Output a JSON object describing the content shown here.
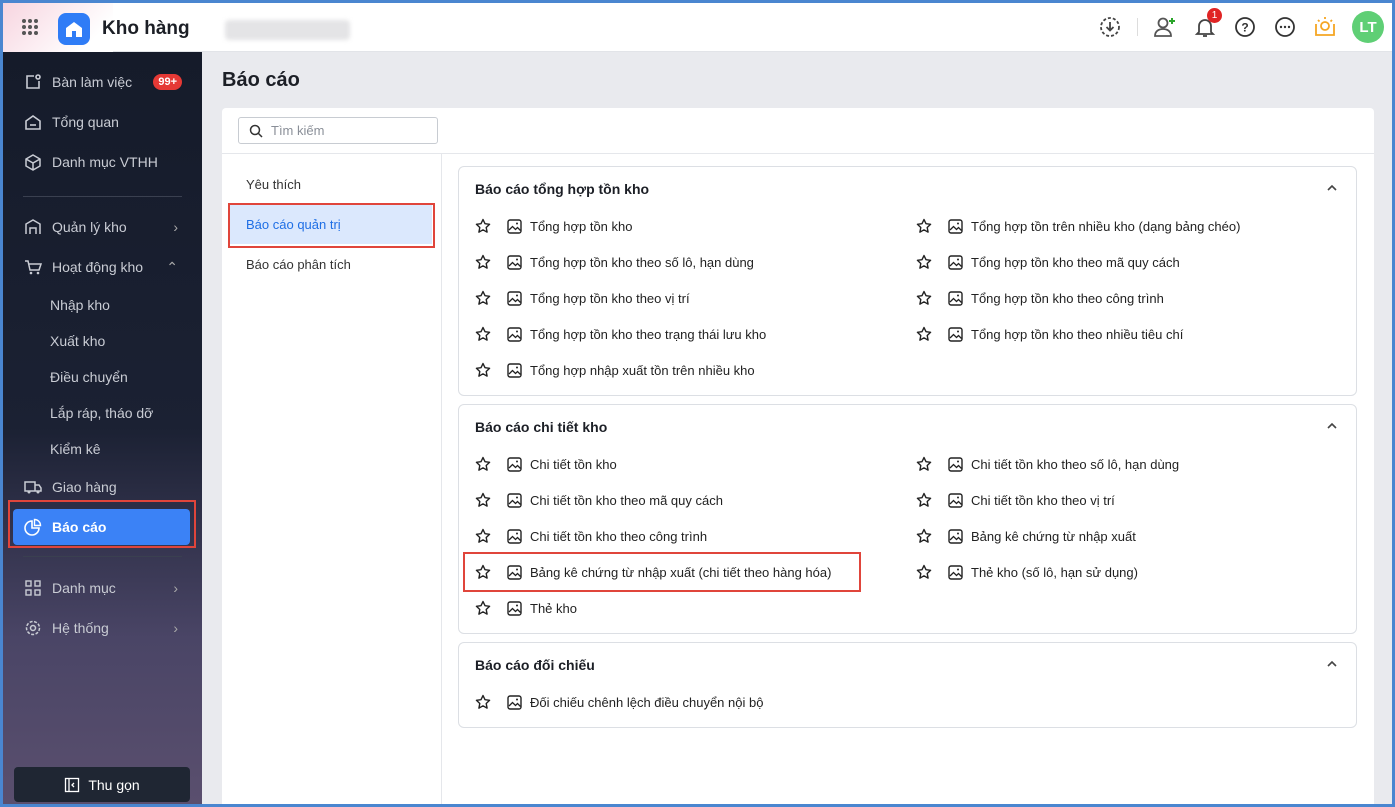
{
  "header": {
    "app_title": "Kho hàng",
    "notification_count": "1",
    "avatar_initials": "LT"
  },
  "sidebar": {
    "items": [
      {
        "label": "Bàn làm việc",
        "badge": "99+"
      },
      {
        "label": "Tổng quan"
      },
      {
        "label": "Danh mục VTHH"
      },
      {
        "label": "Quản lý kho"
      },
      {
        "label": "Hoạt động kho"
      },
      {
        "label": "Nhập kho"
      },
      {
        "label": "Xuất kho"
      },
      {
        "label": "Điều chuyển"
      },
      {
        "label": "Lắp ráp, tháo dỡ"
      },
      {
        "label": "Kiểm kê"
      },
      {
        "label": "Giao hàng"
      },
      {
        "label": "Báo cáo"
      },
      {
        "label": "Danh mục"
      },
      {
        "label": "Hệ thống"
      }
    ],
    "collapse_label": "Thu gọn"
  },
  "page": {
    "title": "Báo cáo",
    "search_placeholder": "Tìm kiếm"
  },
  "left_nav": [
    "Yêu thích",
    "Báo cáo quản trị",
    "Báo cáo phân tích"
  ],
  "groups": [
    {
      "title": "Báo cáo tổng hợp tồn kho",
      "items": [
        "Tổng hợp tồn kho",
        "Tổng hợp tồn trên nhiều kho (dạng bảng chéo)",
        "Tổng hợp tồn kho theo số lô, hạn dùng",
        "Tổng hợp tồn kho theo mã quy cách",
        "Tổng hợp tồn kho theo vị trí",
        "Tổng hợp tồn kho theo công trình",
        "Tổng hợp tồn kho theo trạng thái lưu kho",
        "Tổng hợp tồn kho theo nhiều tiêu chí",
        "Tổng hợp nhập xuất tồn trên nhiều kho"
      ]
    },
    {
      "title": "Báo cáo chi tiết kho",
      "items": [
        "Chi tiết tồn kho",
        "Chi tiết tồn kho theo số lô, hạn dùng",
        "Chi tiết tồn kho theo mã quy cách",
        "Chi tiết tồn kho theo vị trí",
        "Chi tiết tồn kho theo công trình",
        "Bảng kê chứng từ nhập xuất",
        "Bảng kê chứng từ nhập xuất (chi tiết theo hàng hóa)",
        "Thẻ kho (số lô, hạn sử dụng)",
        "Thẻ kho"
      ]
    },
    {
      "title": "Báo cáo đối chiếu",
      "items": [
        "Đối chiếu chênh lệch điều chuyển nội bộ"
      ]
    }
  ]
}
